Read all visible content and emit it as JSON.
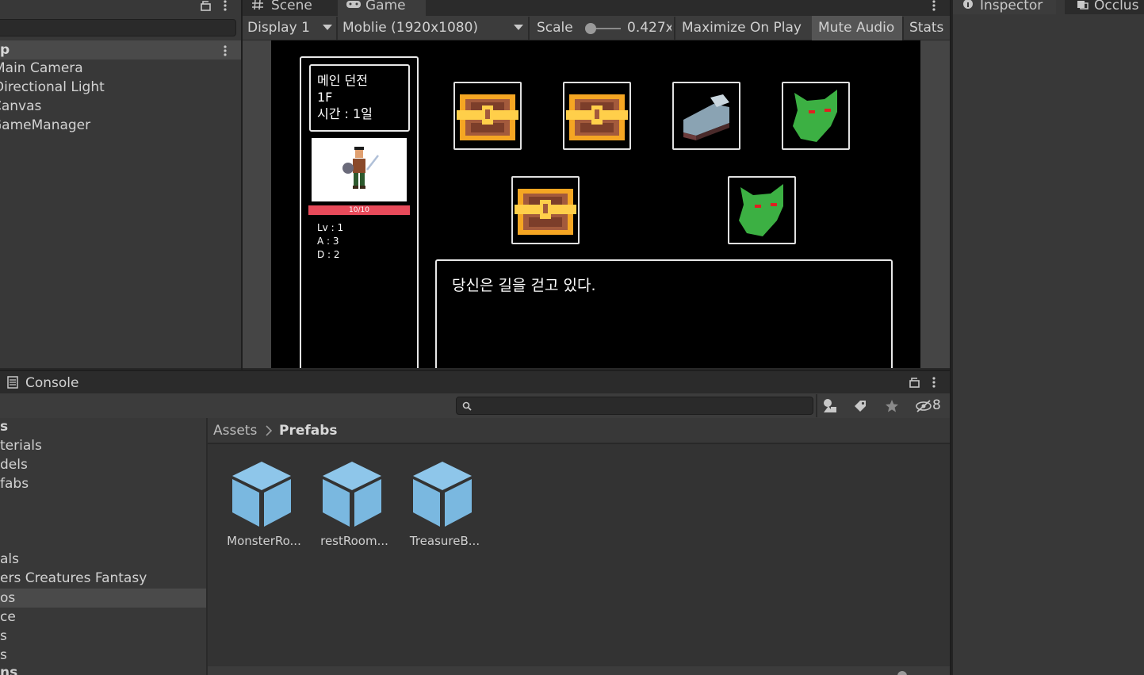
{
  "hierarchy": {
    "scene_label": "p",
    "items": [
      "Main Camera",
      "Directional Light",
      "Canvas",
      "GameManager"
    ]
  },
  "tabs": {
    "scene": "Scene",
    "game": "Game",
    "inspector": "Inspector",
    "occlusion": "Occlus"
  },
  "game_toolbar": {
    "display": "Display 1",
    "resolution": "Moblie (1920x1080)",
    "scale_label": "Scale",
    "scale_value": "0.427x",
    "maximize": "Maximize On Play",
    "mute": "Mute Audio",
    "stats": "Stats"
  },
  "game": {
    "info": {
      "dungeon": "메인 던전",
      "floor": "1F",
      "time": "시간 : 1일"
    },
    "hp_text": "10/10",
    "hp_fraction": 1.0,
    "stats": {
      "lv": "Lv : 1",
      "atk": "A : 3",
      "def": "D : 2"
    },
    "message": "당신은 길을 걷고 있다.",
    "rooms": [
      "treasure-chest",
      "treasure-chest",
      "rest-bed",
      "monster",
      "treasure-chest",
      "monster"
    ]
  },
  "console": {
    "title": "Console"
  },
  "project": {
    "hidden_count": "8",
    "tree": [
      "s",
      "terials",
      "dels",
      "fabs",
      "als",
      "ers Creatures Fantasy",
      "os",
      "ce",
      "s",
      "s",
      "ns"
    ],
    "breadcrumb": {
      "root": "Assets",
      "current": "Prefabs"
    },
    "assets": [
      "MonsterRo...",
      "restRoom...",
      "TreasureB..."
    ]
  },
  "colors": {
    "hp_bar": "#e84a5a",
    "prefab_icon": "#7ab8e0",
    "chest_gold": "#f5a623",
    "monster_green": "#3cb043"
  }
}
